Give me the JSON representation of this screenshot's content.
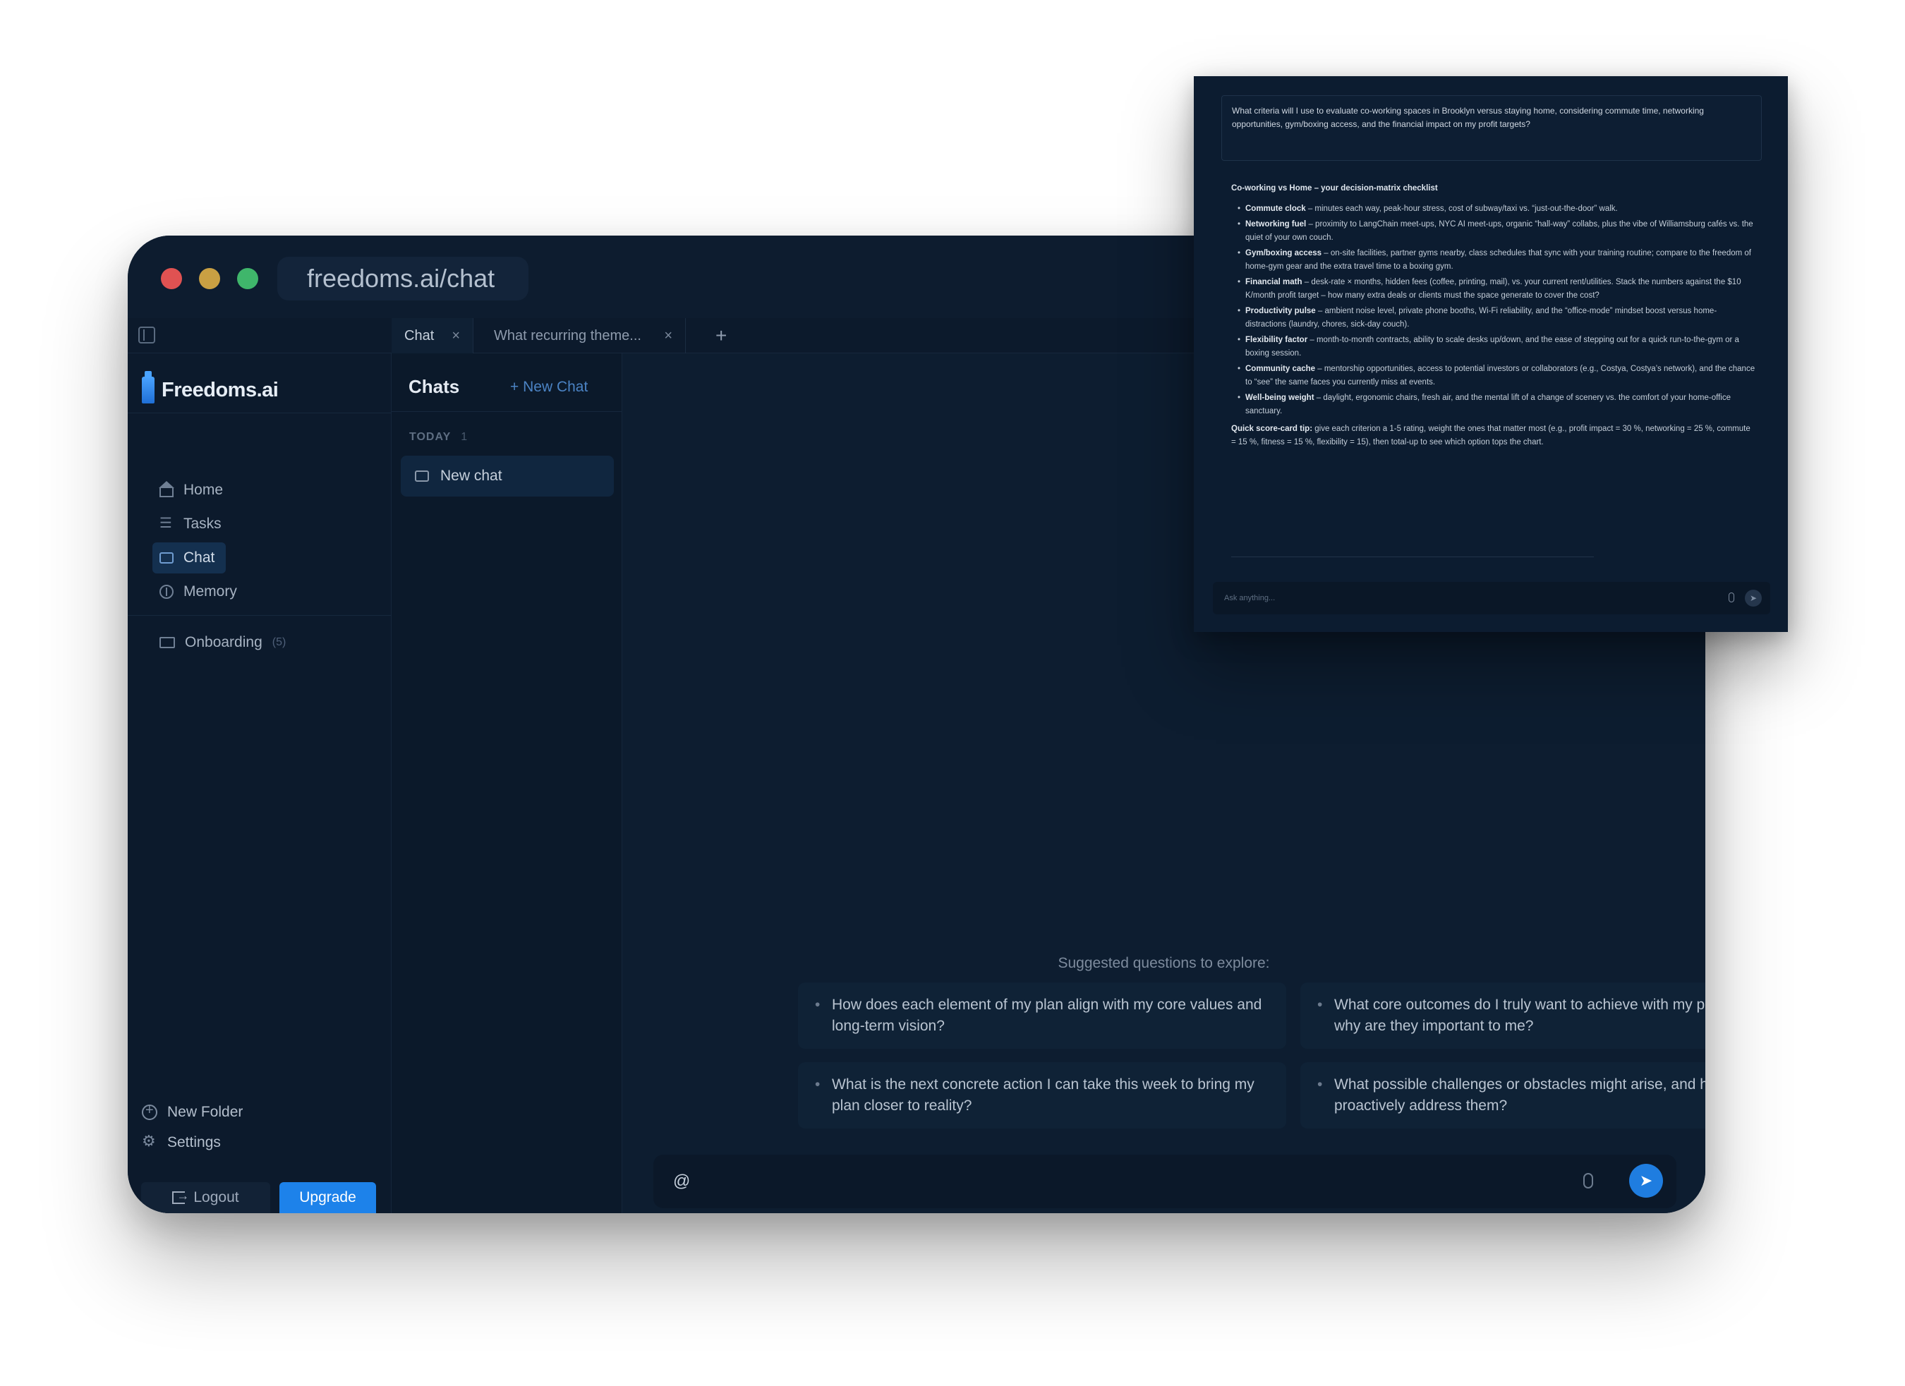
{
  "window": {
    "url": "freedoms.ai/chat"
  },
  "tabs": [
    {
      "label": "Chat",
      "close": "×"
    },
    {
      "label": "What recurring theme...",
      "close": "×"
    }
  ],
  "tab_add": "+",
  "sidebar": {
    "brand": "Freedoms.ai",
    "nav": [
      {
        "label": "Home",
        "icon": "home-icon"
      },
      {
        "label": "Tasks",
        "icon": "tasks-icon"
      },
      {
        "label": "Chat",
        "icon": "chat-icon",
        "active": true
      },
      {
        "label": "Memory",
        "icon": "memory-icon"
      }
    ],
    "folder": {
      "label": "Onboarding",
      "count": "(5)"
    },
    "new_folder": "New Folder",
    "settings": "Settings",
    "logout": "Logout",
    "upgrade": "Upgrade"
  },
  "chats": {
    "title": "Chats",
    "new_chat": "+ New Chat",
    "section": "TODAY",
    "section_count": "1",
    "items": [
      "New chat"
    ]
  },
  "main": {
    "suggest_title": "Suggested questions to explore:",
    "suggestions": [
      "How does each element of my plan align with my core values and long-term vision?",
      "What core outcomes do I truly want to achieve with my plan, and why are they important to me?",
      "What is the next concrete action I can take this week to bring my plan closer to reality?",
      "What possible challenges or obstacles might arise, and how can I proactively address them?"
    ],
    "composer_value": "@",
    "send_icon": "➤"
  },
  "preview": {
    "question": "What criteria will I use to evaluate co-working spaces in Brooklyn versus staying home, considering commute time, networking opportunities, gym/boxing access, and the financial impact on my profit targets?",
    "answer_title": "Co-working vs Home – your decision-matrix checklist",
    "bullets": [
      {
        "term": "Commute clock",
        "text": " – minutes each way, peak-hour stress, cost of subway/taxi vs. “just-out-the-door” walk."
      },
      {
        "term": "Networking fuel",
        "text": " – proximity to LangChain meet-ups, NYC AI meet-ups, organic “hall-way” collabs, plus the vibe of Williamsburg cafés vs. the quiet of your own couch."
      },
      {
        "term": "Gym/boxing access",
        "text": " – on-site facilities, partner gyms nearby, class schedules that sync with your training routine; compare to the freedom of home-gym gear and the extra travel time to a boxing gym."
      },
      {
        "term": "Financial math",
        "text": " – desk-rate × months, hidden fees (coffee, printing, mail), vs. your current rent/utilities. Stack the numbers against the $10 K/month profit target – how many extra deals or clients must the space generate to cover the cost?"
      },
      {
        "term": "Productivity pulse",
        "text": " – ambient noise level, private phone booths, Wi-Fi reliability, and the “office-mode” mindset boost versus home-distractions (laundry, chores, sick-day couch)."
      },
      {
        "term": "Flexibility factor",
        "text": " – month-to-month contracts, ability to scale desks up/down, and the ease of stepping out for a quick run-to-the-gym or a boxing session."
      },
      {
        "term": "Community cache",
        "text": " – mentorship opportunities, access to potential investors or collaborators (e.g., Costya, Costya’s network), and the chance to “see” the same faces you currently miss at events."
      },
      {
        "term": "Well-being weight",
        "text": " – daylight, ergonomic chairs, fresh air, and the mental lift of a change of scenery vs. the comfort of your home-office sanctuary."
      }
    ],
    "tip_term": "Quick score-card tip:",
    "tip_text": " give each criterion a 1-5 rating, weight the ones that matter most (e.g., profit impact = 30 %, networking = 25 %, commute = 15 %, fitness = 15 %, flexibility = 15), then total-up to see which option tops the chart.",
    "composer_placeholder": "Ask anything...",
    "send_icon": "➤"
  }
}
